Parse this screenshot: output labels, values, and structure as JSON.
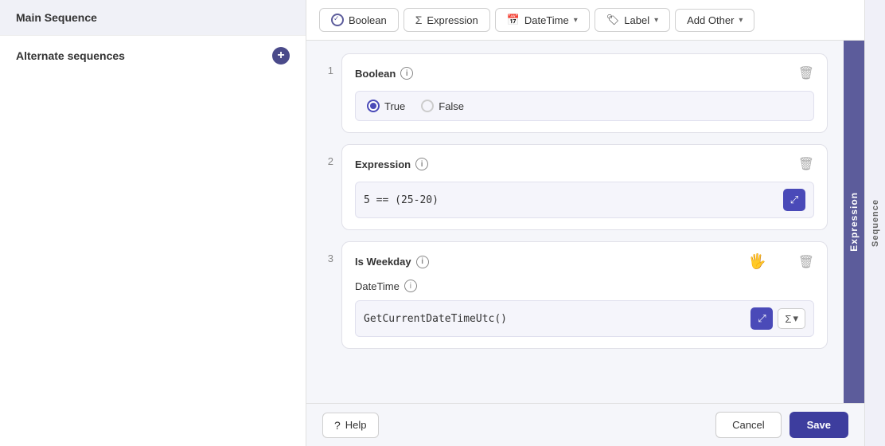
{
  "sidebar": {
    "main_sequence_label": "Main Sequence",
    "alternate_sequences_label": "Alternate sequences",
    "add_button_label": "+"
  },
  "toolbar": {
    "boolean_label": "Boolean",
    "expression_label": "Expression",
    "datetime_label": "DateTime",
    "label_label": "Label",
    "add_other_label": "Add Other"
  },
  "cards": [
    {
      "number": "1",
      "type": "boolean",
      "title": "Boolean",
      "radio_true": "True",
      "radio_false": "False",
      "selected": "True"
    },
    {
      "number": "2",
      "type": "expression",
      "title": "Expression",
      "value": "5 == (25-20)"
    },
    {
      "number": "3",
      "type": "datetime",
      "title": "Is Weekday",
      "subtitle": "DateTime",
      "value": "GetCurrentDateTimeUtc()"
    }
  ],
  "side_tab": {
    "label": "Expression"
  },
  "sequence_tab": {
    "label": "Sequence"
  },
  "footer": {
    "help_label": "Help",
    "cancel_label": "Cancel",
    "save_label": "Save"
  },
  "icons": {
    "check": "✓",
    "info": "i",
    "delete": "🗑",
    "chevron_down": "▾",
    "question": "?",
    "sigma": "Σ",
    "expand": "⤢"
  }
}
